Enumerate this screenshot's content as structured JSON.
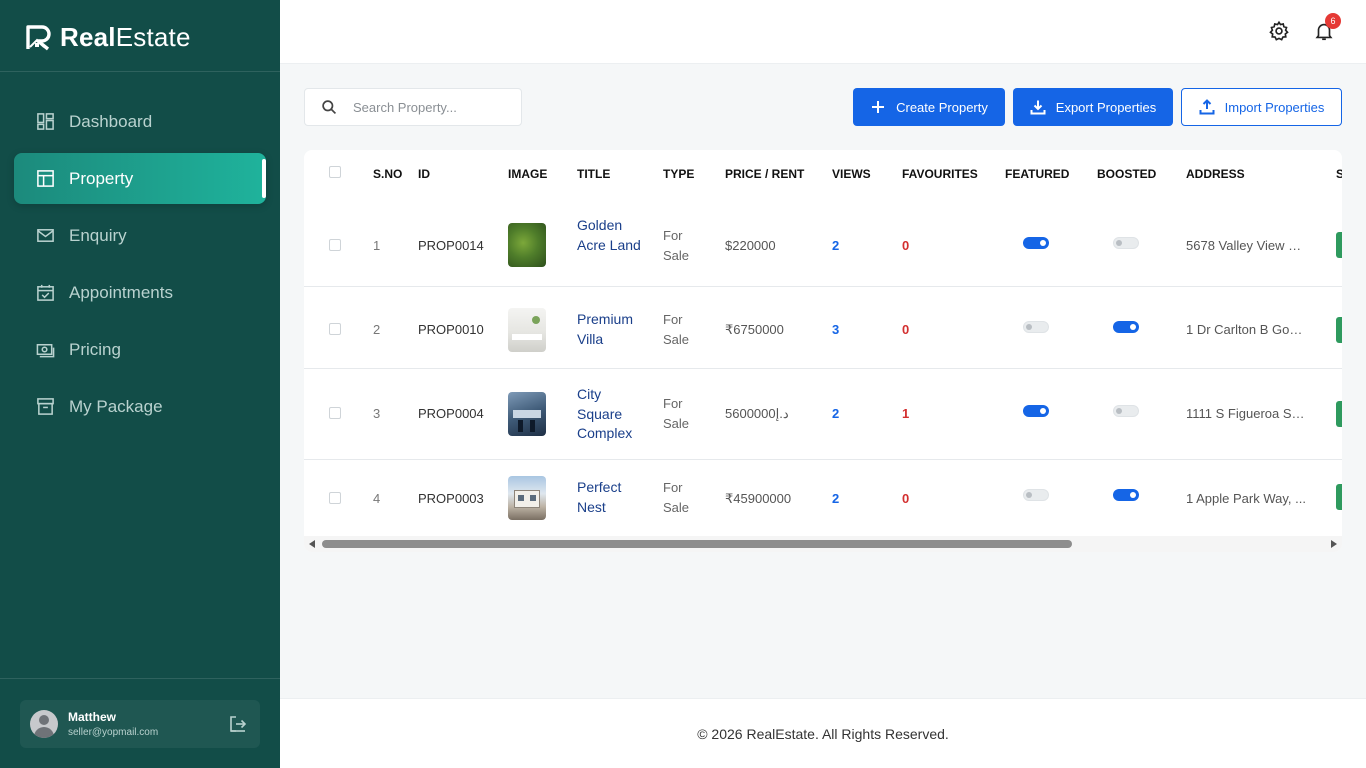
{
  "brand": {
    "bold": "Real",
    "light": "Estate"
  },
  "sidebar": {
    "items": [
      {
        "label": "Dashboard",
        "icon": "dashboard-icon"
      },
      {
        "label": "Property",
        "icon": "property-icon",
        "active": true
      },
      {
        "label": "Enquiry",
        "icon": "mail-icon"
      },
      {
        "label": "Appointments",
        "icon": "calendar-check-icon"
      },
      {
        "label": "Pricing",
        "icon": "money-icon"
      },
      {
        "label": "My Package",
        "icon": "package-icon"
      }
    ],
    "user": {
      "name": "Matthew",
      "email": "seller@yopmail.com"
    }
  },
  "topbar": {
    "notification_count": "6"
  },
  "toolbar": {
    "search_placeholder": "Search Property...",
    "create_label": "Create Property",
    "export_label": "Export Properties",
    "import_label": "Import Properties"
  },
  "table": {
    "headers": {
      "sno": "S.NO",
      "id": "ID",
      "image": "IMAGE",
      "title": "TITLE",
      "type": "TYPE",
      "price": "PRICE / RENT",
      "views": "VIEWS",
      "favourites": "FAVOURITES",
      "featured": "FEATURED",
      "boosted": "BOOSTED",
      "address": "ADDRESS",
      "status_partial": "S"
    },
    "rows": [
      {
        "sno": "1",
        "id": "PROP0014",
        "title": "Golden Acre Land",
        "type": "For Sale",
        "price": "$220000",
        "views": "2",
        "favourites": "0",
        "featured": true,
        "boosted": false,
        "address": "5678 Valley View R..."
      },
      {
        "sno": "2",
        "id": "PROP0010",
        "title": "Premium Villa",
        "type": "For Sale",
        "price": "₹6750000",
        "views": "3",
        "favourites": "0",
        "featured": false,
        "boosted": true,
        "address": "1 Dr Carlton B Goo..."
      },
      {
        "sno": "3",
        "id": "PROP0004",
        "title": "City Square Complex",
        "type": "For Sale",
        "price": "د.إ5600000",
        "views": "2",
        "favourites": "1",
        "featured": true,
        "boosted": false,
        "address": "1111 S Figueroa St, ..."
      },
      {
        "sno": "4",
        "id": "PROP0003",
        "title": "Perfect Nest",
        "type": "For Sale",
        "price": "₹45900000",
        "views": "2",
        "favourites": "0",
        "featured": false,
        "boosted": true,
        "address": "1 Apple Park Way, ..."
      }
    ]
  },
  "colors": {
    "sidebar": "#124d48",
    "active": "#1fb39c",
    "primary": "#1565e6",
    "danger": "#d32f2f"
  },
  "footer": {
    "text": "© 2026 RealEstate. All Rights Reserved."
  }
}
